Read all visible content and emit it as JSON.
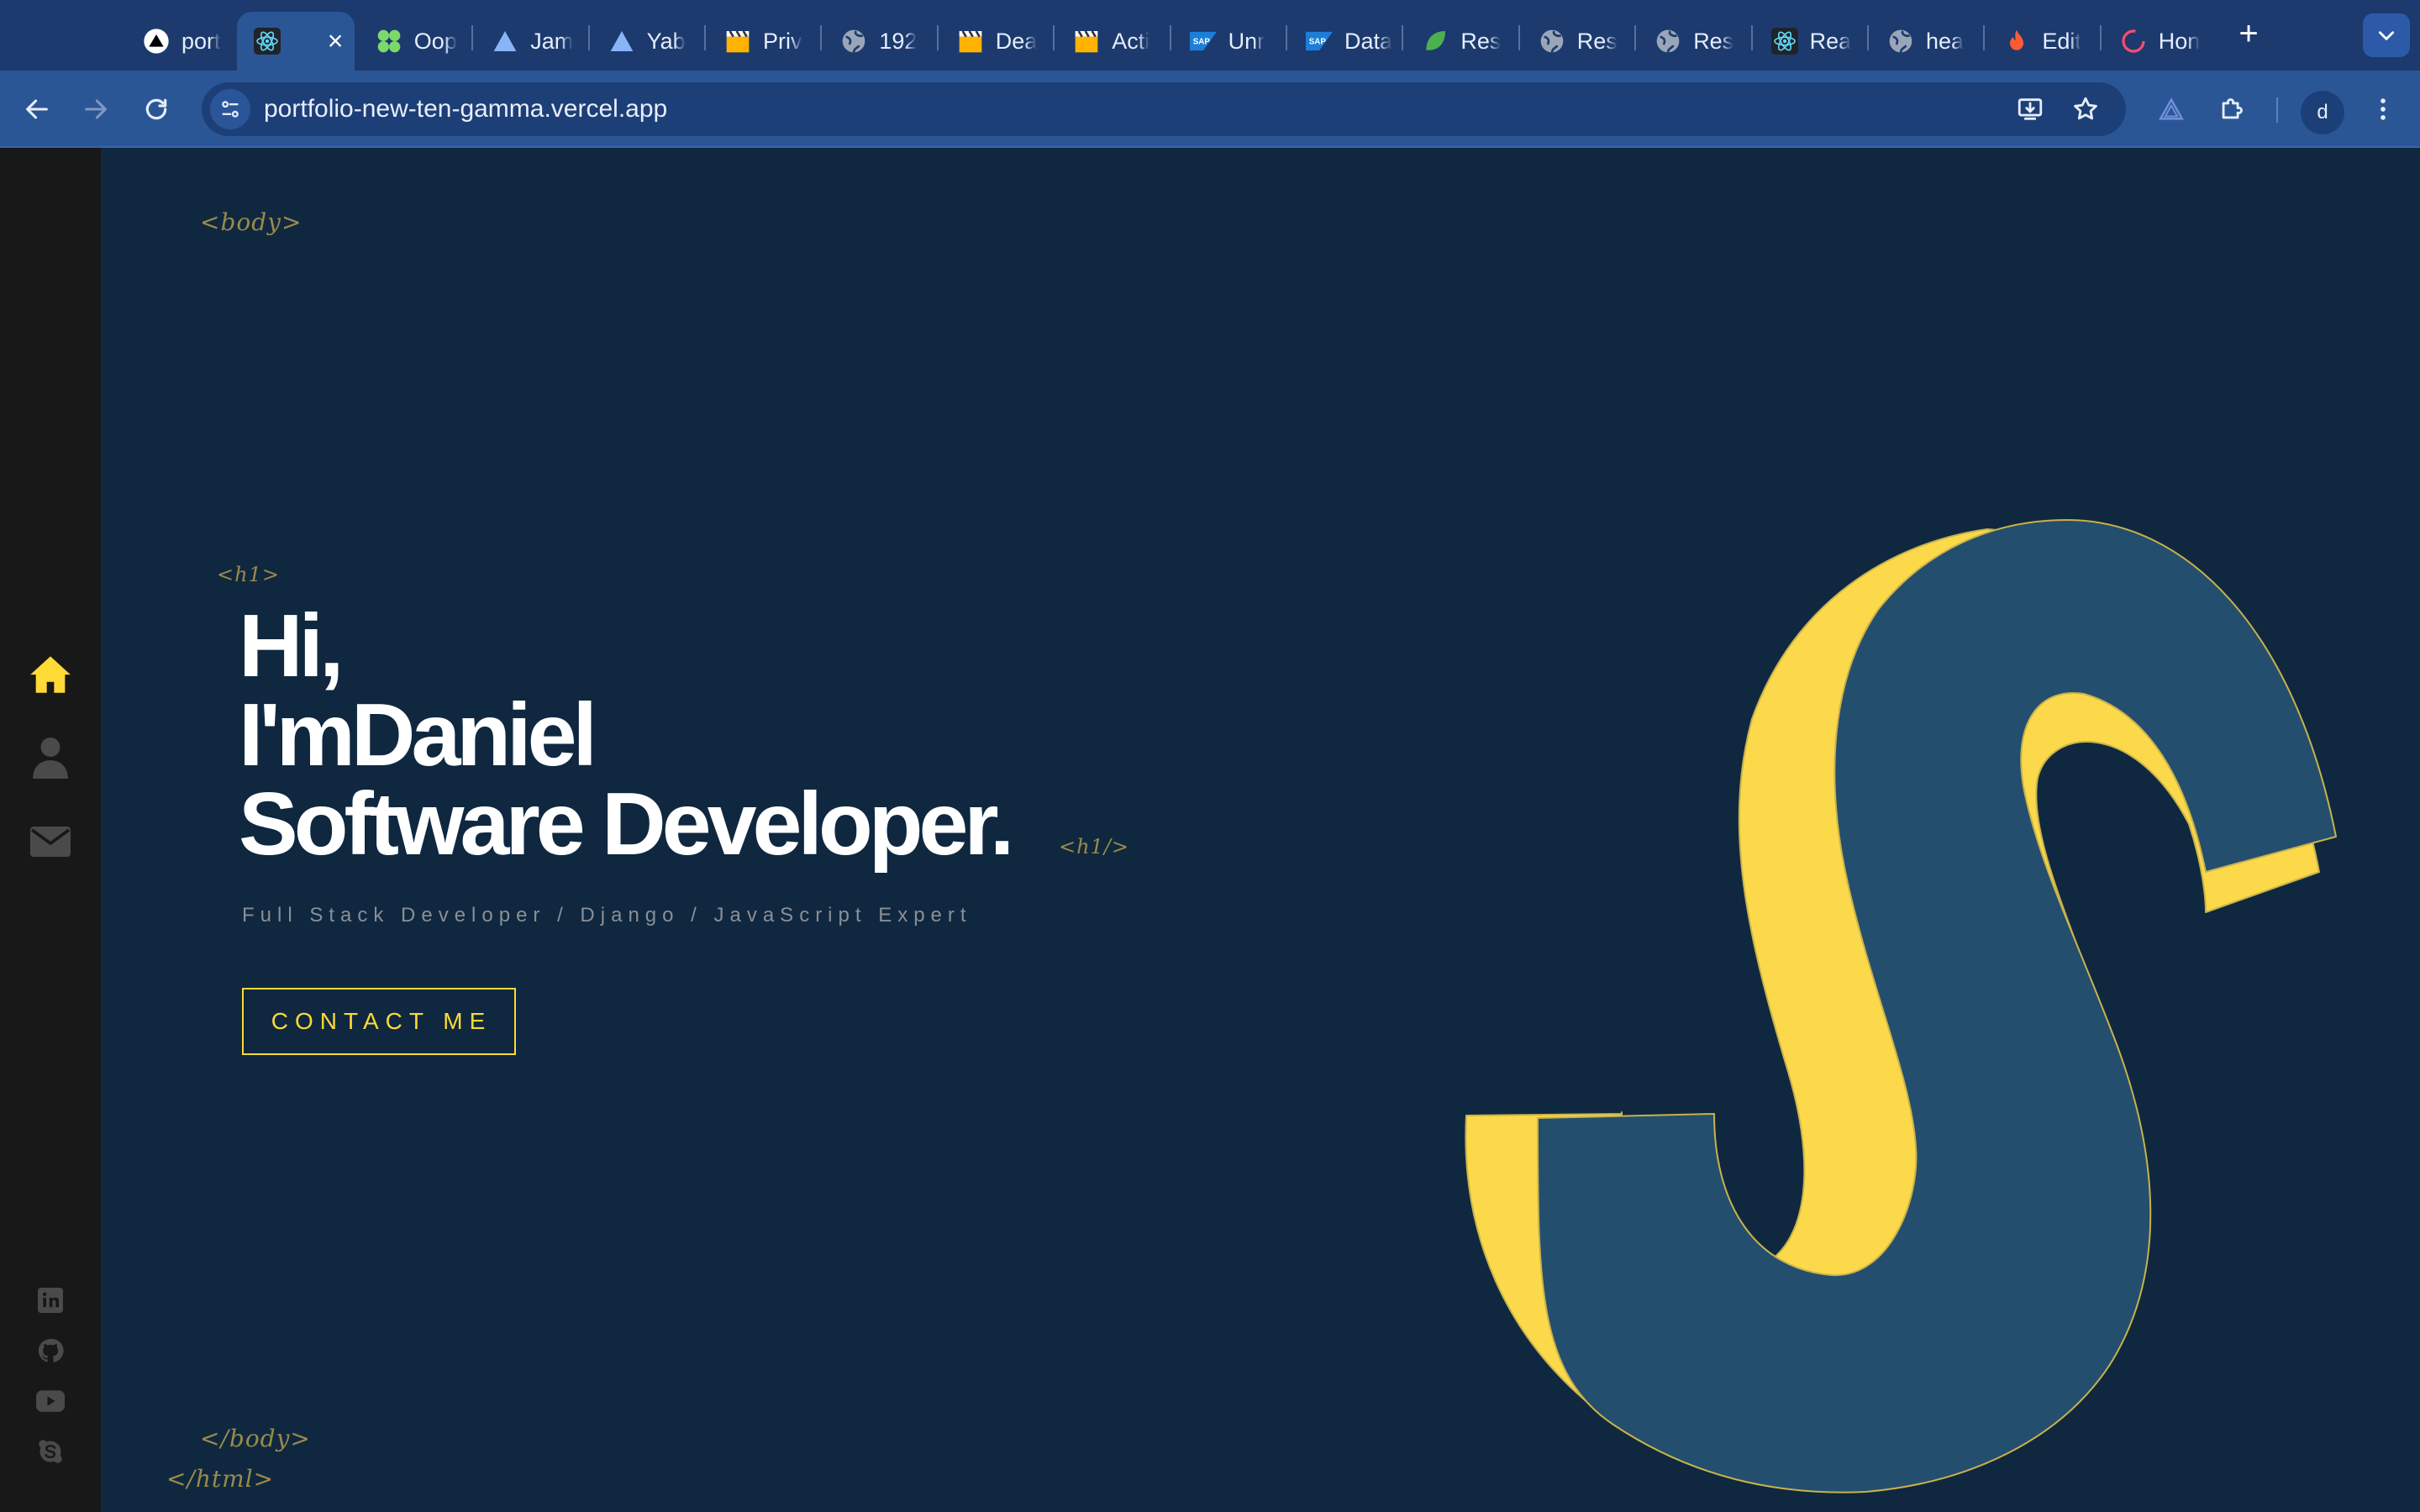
{
  "browser": {
    "tabs": [
      {
        "title": "port",
        "icon": "vercel-triangle-icon",
        "active": false
      },
      {
        "title": "",
        "icon": "react-icon",
        "active": true
      },
      {
        "title": "Oop",
        "icon": "clover-icon",
        "active": false
      },
      {
        "title": "Jam",
        "icon": "triangle-icon",
        "active": false
      },
      {
        "title": "Yab",
        "icon": "triangle-icon",
        "active": false
      },
      {
        "title": "Priv",
        "icon": "clapperboard-icon",
        "active": false
      },
      {
        "title": "192",
        "icon": "globe-icon",
        "active": false
      },
      {
        "title": "Dea",
        "icon": "clapperboard-icon",
        "active": false
      },
      {
        "title": "Acti",
        "icon": "clapperboard-icon",
        "active": false
      },
      {
        "title": "Unr",
        "icon": "sap-icon",
        "active": false
      },
      {
        "title": "Data",
        "icon": "sap-icon",
        "active": false
      },
      {
        "title": "Res",
        "icon": "leaf-icon",
        "active": false
      },
      {
        "title": "Res",
        "icon": "globe-icon",
        "active": false
      },
      {
        "title": "Res",
        "icon": "globe-icon",
        "active": false
      },
      {
        "title": "Rea",
        "icon": "react-icon",
        "active": false
      },
      {
        "title": "hea",
        "icon": "globe-icon",
        "active": false
      },
      {
        "title": "Edit",
        "icon": "flame-icon",
        "active": false
      },
      {
        "title": "Hon",
        "icon": "swirl-icon",
        "active": false
      }
    ],
    "close_label": "×",
    "new_tab_label": "+",
    "url": "portfolio-new-ten-gamma.vercel.app",
    "profile_initial": "d",
    "colors": {
      "tabstrip": "#1c3a6e",
      "toolbar": "#2a5696",
      "omnibox": "#1d3f78"
    }
  },
  "page": {
    "tags": {
      "body_open": "<body>",
      "h1_open": "<h1>",
      "h1_close": "<h1/>",
      "body_close": "</body>",
      "html_close": "</html>"
    },
    "hero": {
      "line1": "Hi,",
      "line2": "I'mDaniel",
      "line3": "Software Developer.",
      "subtitle": "Full Stack Developer / Django / JavaScript Expert",
      "cta_label": "CONTACT ME"
    },
    "sidebar": {
      "nav": [
        {
          "name": "home",
          "icon": "home-icon",
          "active": true
        },
        {
          "name": "about",
          "icon": "user-icon",
          "active": false
        },
        {
          "name": "contact",
          "icon": "envelope-icon",
          "active": false
        }
      ],
      "social": [
        "linkedin-icon",
        "github-icon",
        "youtube-icon",
        "skype-icon"
      ]
    },
    "colors": {
      "background": "#0f2840",
      "sidebar": "#181818",
      "accent": "#ffd935",
      "logo_face": "#244e6e"
    }
  }
}
